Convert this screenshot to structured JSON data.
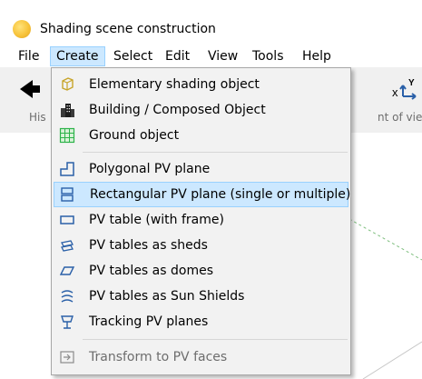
{
  "window": {
    "title": "Shading scene construction"
  },
  "menubar": {
    "items": [
      {
        "label": "File"
      },
      {
        "label": "Create",
        "active": true
      },
      {
        "label": "Select"
      },
      {
        "label": "Edit"
      },
      {
        "label": "View"
      },
      {
        "label": "Tools"
      },
      {
        "label": "Help"
      }
    ]
  },
  "toolbar": {
    "left_partial_label": "His",
    "right_partial_label": "nt of view",
    "axis_icon_labels": {
      "x": "x",
      "y": "Y"
    }
  },
  "create_menu": {
    "items": [
      {
        "label": "Elementary shading object",
        "icon": "elementary-shading-object-icon"
      },
      {
        "label": "Building / Composed Object",
        "icon": "building-icon"
      },
      {
        "label": "Ground object",
        "icon": "ground-grid-icon"
      },
      {
        "label": "Polygonal PV plane",
        "icon": "polygonal-plane-icon"
      },
      {
        "label": "Rectangular PV plane (single or multiple)",
        "icon": "rectangular-plane-icon",
        "highlighted": true
      },
      {
        "label": "PV table (with frame)",
        "icon": "pv-table-icon"
      },
      {
        "label": "PV tables as sheds",
        "icon": "sheds-icon"
      },
      {
        "label": "PV tables as domes",
        "icon": "domes-icon"
      },
      {
        "label": "PV tables as Sun Shields",
        "icon": "sun-shields-icon"
      },
      {
        "label": "Tracking PV planes",
        "icon": "tracking-planes-icon"
      },
      {
        "label": "Transform to PV faces",
        "icon": "transform-faces-icon",
        "disabled": true
      }
    ]
  },
  "colors": {
    "accent_highlight": "#cce8ff",
    "accent_border": "#99d1ff",
    "icon_blue": "#2a60a8",
    "ground_green": "#2db34a",
    "shading_yellow": "#c8a52a",
    "disabled_text": "#6d6d6d"
  }
}
